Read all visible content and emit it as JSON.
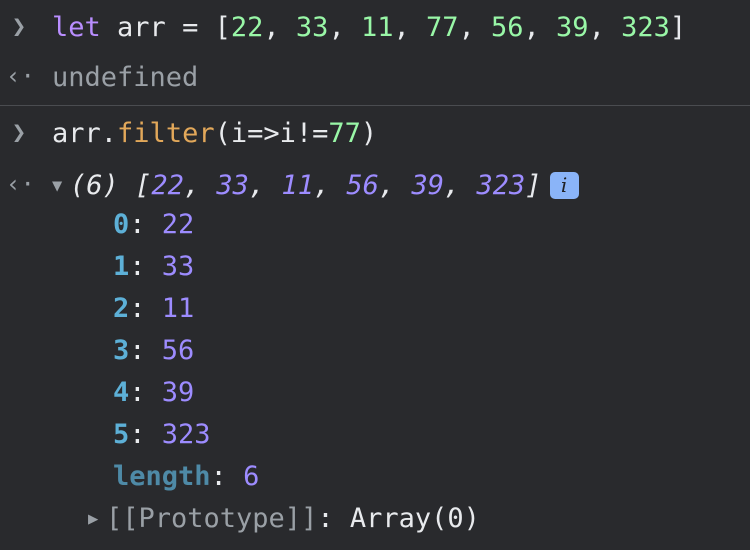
{
  "console": {
    "input1": {
      "prompt_icon": "chevron-right-icon",
      "keyword": "let",
      "variable": "arr",
      "operator": "=",
      "open_bracket": "[",
      "values": [
        "22",
        "33",
        "11",
        "77",
        "56",
        "39",
        "323"
      ],
      "close_bracket": "]"
    },
    "result1": {
      "return_icon": "return-arrow-icon",
      "text": "undefined"
    },
    "input2": {
      "prompt_icon": "chevron-right-icon",
      "object": "arr",
      "dot": ".",
      "method": "filter",
      "args_open": "(i=>i!=",
      "arg_value": "77",
      "args_close": ")"
    },
    "result2": {
      "return_icon": "return-arrow-icon",
      "expand_icon": "triangle-down-icon",
      "length_prefix": "(6)",
      "preview_open": "[",
      "preview_values": [
        "22",
        "33",
        "11",
        "56",
        "39",
        "323"
      ],
      "preview_close": "]",
      "info_badge": "i",
      "entries": [
        {
          "key": "0",
          "value": "22"
        },
        {
          "key": "1",
          "value": "33"
        },
        {
          "key": "2",
          "value": "11"
        },
        {
          "key": "3",
          "value": "56"
        },
        {
          "key": "4",
          "value": "39"
        },
        {
          "key": "5",
          "value": "323"
        }
      ],
      "length_key": "length",
      "length_value": "6",
      "prototype_icon": "triangle-right-icon",
      "prototype_key": "[[Prototype]]",
      "prototype_value": "Array(0)"
    }
  }
}
